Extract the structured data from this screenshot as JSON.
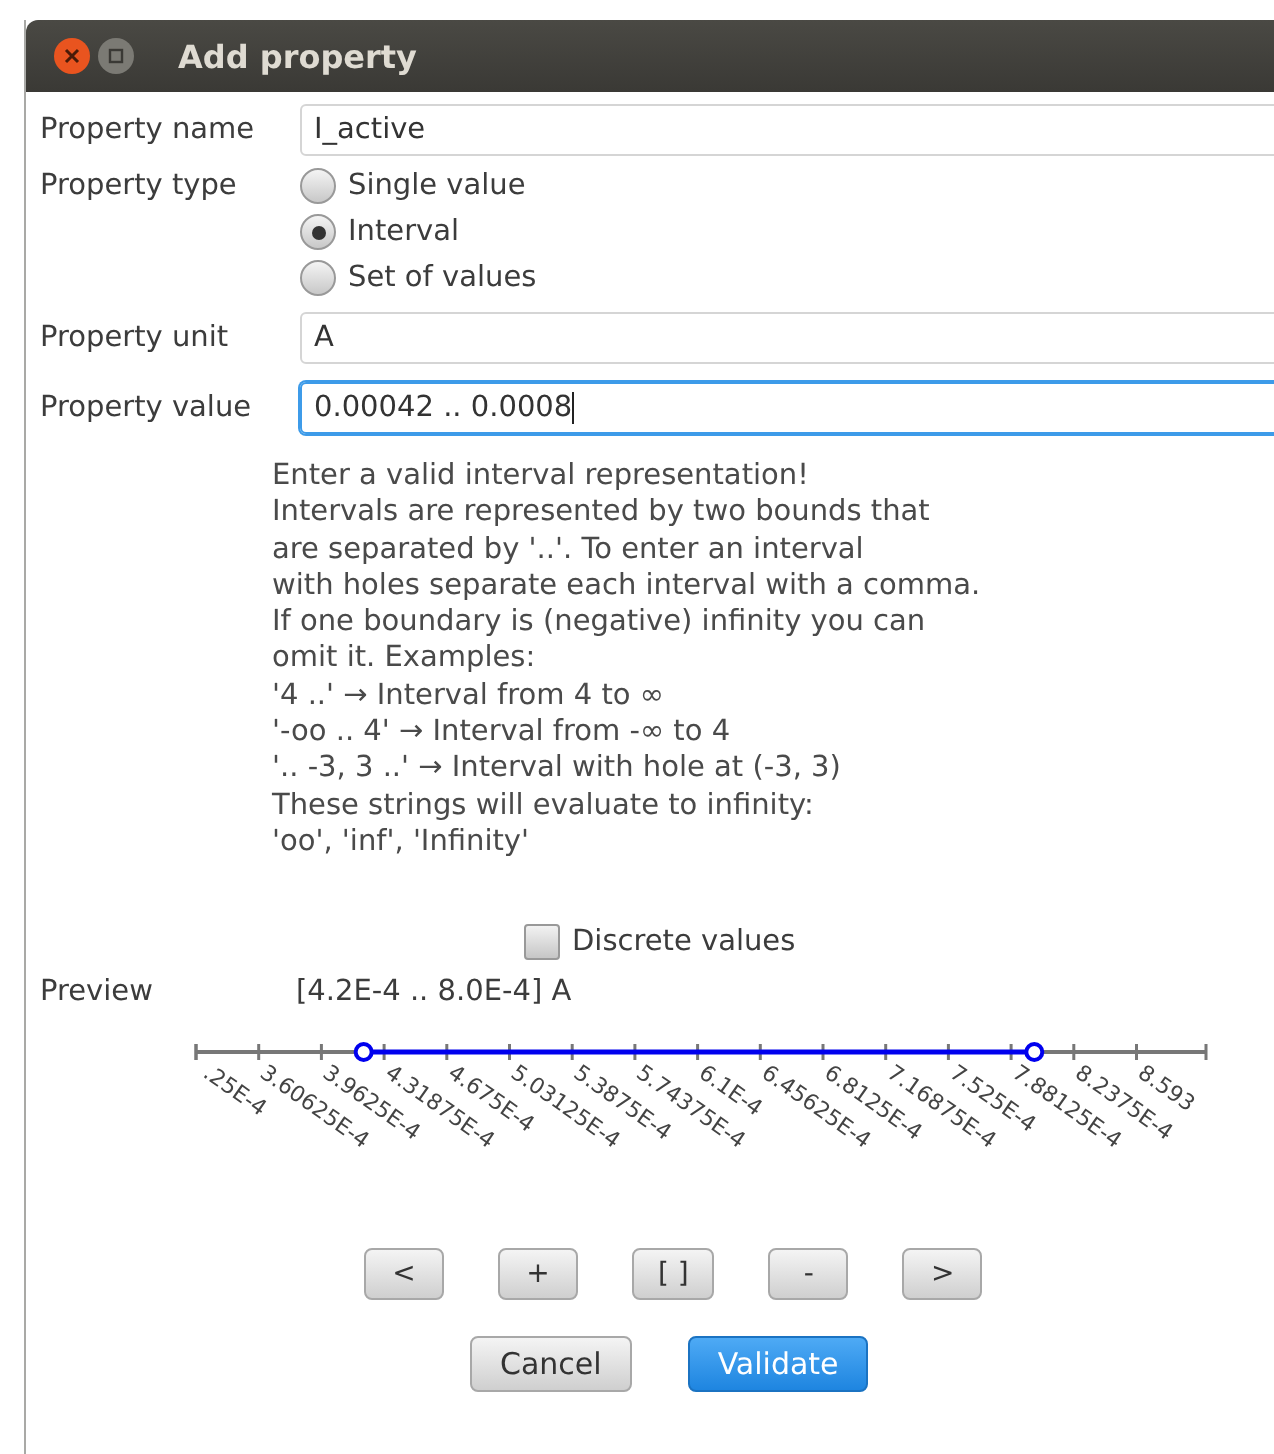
{
  "window": {
    "title": "Add property"
  },
  "form": {
    "name_label": "Property name",
    "name_value": "I_active",
    "type_label": "Property type",
    "type_options": [
      {
        "label": "Single value",
        "selected": false
      },
      {
        "label": "Interval",
        "selected": true
      },
      {
        "label": "Set of values",
        "selected": false
      }
    ],
    "unit_label": "Property unit",
    "unit_value": "A",
    "value_label": "Property value",
    "value_value": "0.00042 .. 0.0008",
    "value_focused": true
  },
  "help_lines": [
    "Enter a valid interval representation!",
    "Intervals are represented by two bounds that",
    "are separated by '..'. To enter an interval",
    "with holes separate each interval with a comma.",
    "If one boundary is (negative) infinity you can",
    "omit it. Examples:",
    "'4 ..' → Interval from 4 to ∞",
    "'-oo .. 4' → Interval from -∞ to 4",
    "'.. -3, 3 ..' → Interval with hole at (-3, 3)",
    "These strings will evaluate to infinity:",
    "'oo', 'inf', 'Infinity'"
  ],
  "discrete": {
    "label": "Discrete values",
    "checked": false
  },
  "preview": {
    "label": "Preview",
    "text": "[4.2E-4 .. 8.0E-4] A",
    "ticks": [
      ".25E-4",
      "3.60625E-4",
      "3.9625E-4",
      "4.31875E-4",
      "4.675E-4",
      "5.03125E-4",
      "5.3875E-4",
      "5.74375E-4",
      "6.1E-4",
      "6.45625E-4",
      "6.8125E-4",
      "7.16875E-4",
      "7.525E-4",
      "7.88125E-4",
      "8.2375E-4",
      "8.593"
    ],
    "range": {
      "start": {
        "level": 0.166
      },
      "end": {
        "level": 0.83
      }
    }
  },
  "tool_buttons": [
    "<",
    "+",
    "[ ]",
    "-",
    ">"
  ],
  "buttons": [
    {
      "label": "Cancel",
      "kind": "normal"
    },
    {
      "label": "Validate",
      "kind": "primary"
    }
  ]
}
